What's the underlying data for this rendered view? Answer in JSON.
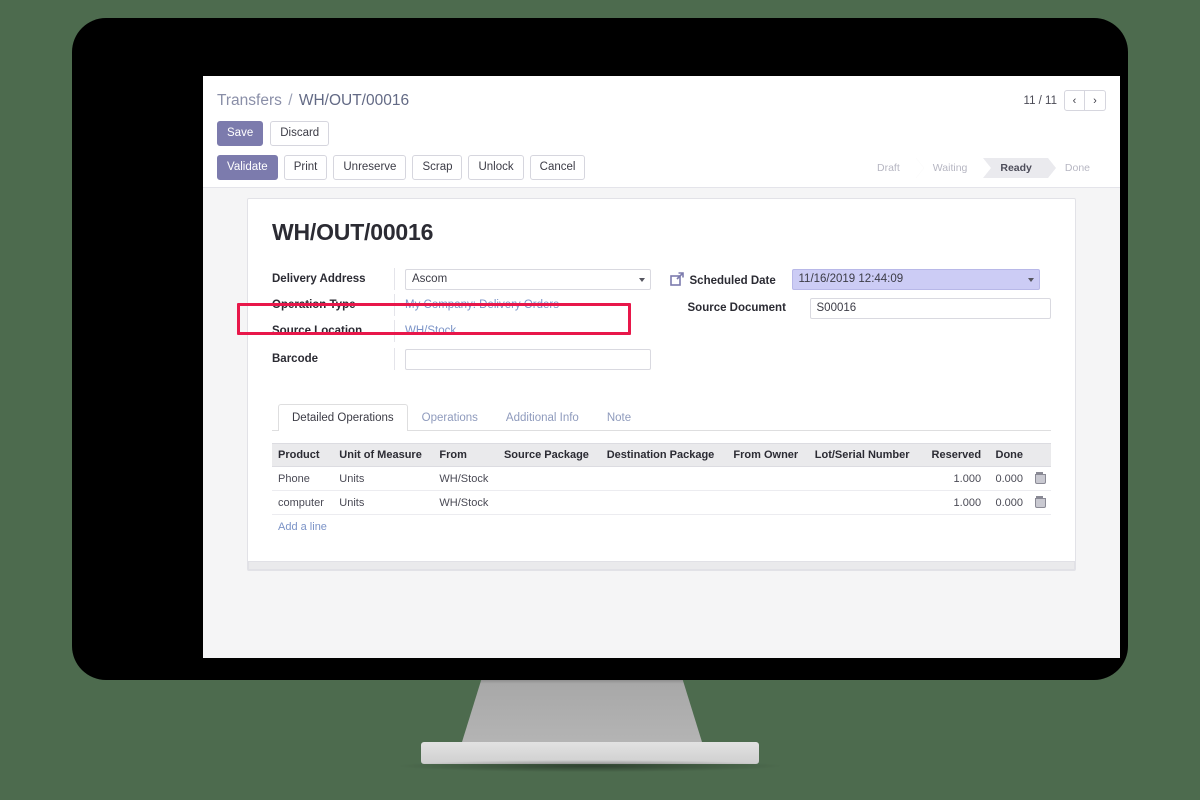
{
  "theme": {
    "page_background": "#4d6b4e",
    "accent": "#7c7bad",
    "link": "#7b93c7",
    "highlight_box": "#e8174a",
    "focused_field": "#ccccf5"
  },
  "breadcrumb": {
    "parent": "Transfers",
    "separator": "/",
    "current": "WH/OUT/00016"
  },
  "pager": {
    "count": "11 / 11",
    "prev_icon": "chevron-left-icon",
    "prev_label": "‹",
    "next_icon": "chevron-right-icon",
    "next_label": "›"
  },
  "edit_buttons": {
    "save": "Save",
    "discard": "Discard"
  },
  "action_buttons": [
    {
      "label": "Validate",
      "primary": true
    },
    {
      "label": "Print",
      "primary": false
    },
    {
      "label": "Unreserve",
      "primary": false
    },
    {
      "label": "Scrap",
      "primary": false
    },
    {
      "label": "Unlock",
      "primary": false
    },
    {
      "label": "Cancel",
      "primary": false
    }
  ],
  "statusbar": [
    {
      "label": "Draft",
      "active": false
    },
    {
      "label": "Waiting",
      "active": false
    },
    {
      "label": "Ready",
      "active": true
    },
    {
      "label": "Done",
      "active": false
    }
  ],
  "record": {
    "title": "WH/OUT/00016"
  },
  "form": {
    "delivery_address": {
      "label": "Delivery Address",
      "value": "Ascom",
      "placeholder": ""
    },
    "operation_type": {
      "label": "Operation Type",
      "value": "My Company: Delivery Orders"
    },
    "source_location": {
      "label": "Source Location",
      "value": "WH/Stock"
    },
    "barcode": {
      "label": "Barcode",
      "value": "",
      "placeholder": ""
    },
    "scheduled_date": {
      "label": "Scheduled Date",
      "value": "11/16/2019 12:44:09",
      "icon": "external-link-icon"
    },
    "source_document": {
      "label": "Source Document",
      "value": "S00016",
      "placeholder": ""
    }
  },
  "tabs": [
    {
      "label": "Detailed Operations",
      "active": true
    },
    {
      "label": "Operations",
      "active": false
    },
    {
      "label": "Additional Info",
      "active": false
    },
    {
      "label": "Note",
      "active": false
    }
  ],
  "lines_table": {
    "columns": [
      "Product",
      "Unit of Measure",
      "From",
      "Source Package",
      "Destination Package",
      "From Owner",
      "Lot/Serial Number",
      "Reserved",
      "Done"
    ],
    "rows": [
      {
        "product": "Phone",
        "uom": "Units",
        "from": "WH/Stock",
        "source_package": "",
        "destination_package": "",
        "from_owner": "",
        "lot_serial": "",
        "reserved": "1.000",
        "done": "0.000",
        "delete_icon": "trash-icon"
      },
      {
        "product": "computer",
        "uom": "Units",
        "from": "WH/Stock",
        "source_package": "",
        "destination_package": "",
        "from_owner": "",
        "lot_serial": "",
        "reserved": "1.000",
        "done": "0.000",
        "delete_icon": "trash-icon"
      }
    ],
    "add_line": "Add a line"
  }
}
